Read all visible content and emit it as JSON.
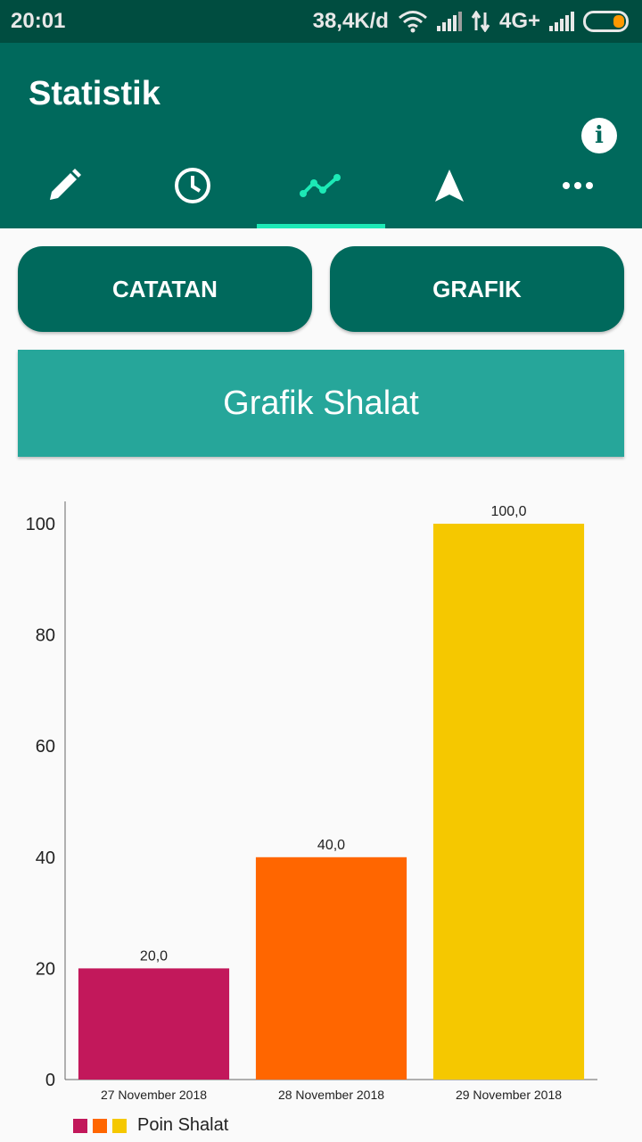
{
  "status_bar": {
    "time": "20:01",
    "network_speed": "38,4K/d",
    "network_type": "4G+",
    "icons": [
      "wifi-icon",
      "signal-icon",
      "data-arrows-icon",
      "signal-icon",
      "battery-icon"
    ],
    "battery_color": "#ff9800"
  },
  "app_bar": {
    "title": "Statistik",
    "info_icon": "info-icon",
    "tabs": [
      {
        "icon": "pencil-icon",
        "active": false
      },
      {
        "icon": "clock-icon",
        "active": false
      },
      {
        "icon": "chart-line-icon",
        "active": true
      },
      {
        "icon": "navigation-arrow-icon",
        "active": false
      },
      {
        "icon": "more-horiz-icon",
        "active": false
      }
    ],
    "active_indicator_color": "#1de9b6"
  },
  "buttons": {
    "catatan": "CATATAN",
    "grafik": "GRAFIK"
  },
  "banner": {
    "title": "Grafik Shalat"
  },
  "chart_data": {
    "type": "bar",
    "categories": [
      "27 November 2018",
      "28 November 2018",
      "29 November 2018"
    ],
    "values": [
      20.0,
      40.0,
      100.0
    ],
    "value_labels": [
      "20,0",
      "40,0",
      "100,0"
    ],
    "colors": [
      "#c2185b",
      "#ff6600",
      "#f5c800"
    ],
    "ylim": [
      0,
      100
    ],
    "yticks": [
      0,
      20,
      40,
      60,
      80,
      100
    ],
    "grid": false,
    "legend": {
      "label": "Poin Shalat",
      "position": "bottom-left"
    }
  }
}
